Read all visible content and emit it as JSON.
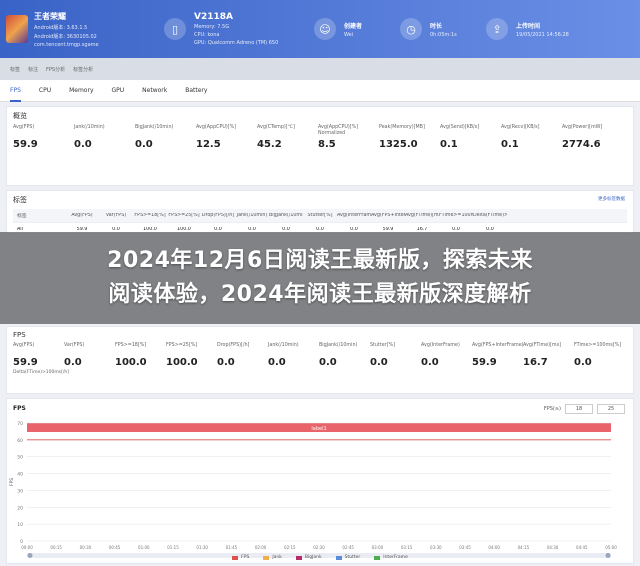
{
  "header": {
    "game": {
      "title": "王者荣耀",
      "line1": "Android版本: 3.63.1.5",
      "line2": "Android版本: 3630105.02",
      "line3": "com.tencent.tmgp.sgame"
    },
    "device": {
      "title": "V2118A",
      "line1": "Memory: 7.5G",
      "line2": "CPU: kona",
      "line3": "GPU: Qualcomm Adreno (TM) 650"
    },
    "creator": {
      "label": "创建者",
      "value": "Wei"
    },
    "duration": {
      "label": "时长",
      "value": "0h:05m:1s"
    },
    "upload": {
      "label": "上传时间",
      "value": "19/05/2021 14:56:28"
    }
  },
  "subbar": {
    "items": [
      "标签",
      "标注",
      "FPS分析",
      "标签分析"
    ]
  },
  "tabs": [
    "FPS",
    "CPU",
    "Memory",
    "GPU",
    "Network",
    "Battery"
  ],
  "overview": {
    "title": "概览",
    "kpis": [
      {
        "label": "Avg(FPS)",
        "value": "59.9"
      },
      {
        "label": "Jank(/10min)",
        "value": "0.0"
      },
      {
        "label": "BigJank(/10min)",
        "value": "0.0"
      },
      {
        "label": "Avg(AppCPU)[%]",
        "value": "12.5"
      },
      {
        "label": "Avg(CTemp)[℃]",
        "value": "45.2"
      },
      {
        "label": "Avg(AppCPU)[%] Normalized",
        "value": "8.5"
      },
      {
        "label": "Peak(Memory)[MB]",
        "value": "1325.0"
      },
      {
        "label": "Avg(Send)[KB/s]",
        "value": "0.1"
      },
      {
        "label": "Avg(Recv)[KB/s]",
        "value": "0.1"
      },
      {
        "label": "Avg(Power)[mW]",
        "value": "2774.6"
      }
    ]
  },
  "labels_table": {
    "title": "标签",
    "link": "更多标签数据",
    "headers": [
      "标签",
      "Avg(FPS)",
      "Var(FPS)",
      "FPS>=18[%]",
      "FPS>=25[%]",
      "Drop(FPS)[/h]",
      "Jank(/10min)",
      "BigJank(/10min)",
      "Stutter[%]",
      "Avg(InterFrame)",
      "Avg(FPS+InterFrame)",
      "Avg(FTime)[ms]",
      "FTime>=100ms[%]",
      "Delta(FTime)>100ms[/h]"
    ],
    "rows": [
      {
        "cells": [
          "All",
          "59.9",
          "0.0",
          "100.0",
          "100.0",
          "0.0",
          "0.0",
          "0.0",
          "0.0",
          "0.0",
          "59.9",
          "16.7",
          "0.0",
          "0.0"
        ]
      }
    ]
  },
  "banner": {
    "line1": "2024年12月6日阅读王最新版，探索未来",
    "line2": "阅读体验，2024年阅读王最新版深度解析"
  },
  "fps_section": {
    "title": "FPS",
    "kpis": [
      {
        "label": "Avg(FPS)",
        "value": "59.9"
      },
      {
        "label": "Var(FPS)",
        "value": "0.0"
      },
      {
        "label": "FPS>=18[%]",
        "value": "100.0"
      },
      {
        "label": "FPS>=25[%]",
        "value": "100.0"
      },
      {
        "label": "Drop(FPS)[/h]",
        "value": "0.0"
      },
      {
        "label": "Jank(/10min)",
        "value": "0.0"
      },
      {
        "label": "BigJank(/10min)",
        "value": "0.0"
      },
      {
        "label": "Stutter[%]",
        "value": "0.0"
      },
      {
        "label": "Avg(InterFrame)",
        "value": "0.0"
      },
      {
        "label": "Avg(FPS+InterFrame)",
        "value": "59.9"
      },
      {
        "label": "Avg(FTime)[ms]",
        "value": "16.7"
      },
      {
        "label": "FTime>=100ms[%]",
        "value": "0.0"
      }
    ],
    "extra_label": "Delta(FTime)>100ms[/h]",
    "extra_value": "0.0"
  },
  "chart": {
    "title": "FPS",
    "ctl_label": "FPS(≥)",
    "ctl_a": "18",
    "ctl_b": "25",
    "band_label": "label1",
    "legend": [
      "FPS",
      "Jank",
      "BigJank",
      "Stutter",
      "InterFrame"
    ],
    "colors": {
      "fps": "#d9534f",
      "jank": "#f0ad4e",
      "bigjank": "#b52e6b",
      "stutter": "#5b8bd9",
      "interframe": "#4cae4c",
      "band": "#e8636a"
    }
  },
  "chart_data": {
    "type": "line",
    "title": "FPS",
    "x": [
      "00:00",
      "00:15",
      "00:30",
      "00:45",
      "01:00",
      "01:15",
      "01:30",
      "01:45",
      "02:00",
      "02:15",
      "02:30",
      "02:45",
      "03:00",
      "03:15",
      "03:30",
      "03:45",
      "04:00",
      "04:15",
      "04:30",
      "04:45",
      "05:00"
    ],
    "series": [
      {
        "name": "FPS",
        "values": [
          60,
          60,
          60,
          60,
          60,
          60,
          60,
          60,
          60,
          60,
          60,
          60,
          60,
          60,
          60,
          60,
          60,
          60,
          60,
          60,
          60
        ]
      }
    ],
    "ylim": [
      0,
      70
    ],
    "yticks": [
      0,
      10,
      20,
      30,
      40,
      50,
      60,
      70
    ]
  }
}
